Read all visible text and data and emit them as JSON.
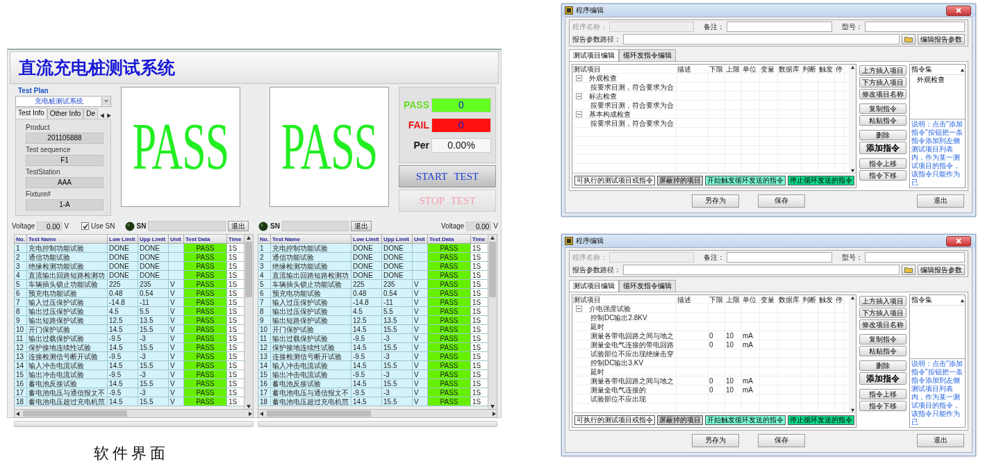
{
  "test_app": {
    "title": "直流充电桩测试系统",
    "test_plan": {
      "label": "Test Plan",
      "plan": "充电桩测试系统",
      "tabs": [
        {
          "label": "Test Info",
          "selected": true
        },
        {
          "label": "Other Info",
          "selected": false
        },
        {
          "label": "De",
          "selected": false
        }
      ],
      "fields": [
        {
          "label": "Product",
          "value": "201105888"
        },
        {
          "label": "Test sequence",
          "value": "F1"
        },
        {
          "label": "TestStation",
          "value": "AAA"
        },
        {
          "label": "Fixture#",
          "value": "1-A"
        }
      ]
    },
    "result_displays": [
      "PASS",
      "PASS"
    ],
    "counters": [
      {
        "kind": "pass",
        "label": "PASS",
        "value": "0"
      },
      {
        "kind": "fail",
        "label": "FAIL",
        "value": "0"
      },
      {
        "kind": "per",
        "label": "Per",
        "value": "0.00%"
      }
    ],
    "buttons": [
      {
        "label": "START TEST",
        "disabled": false
      },
      {
        "label": "STOP TEST",
        "disabled": true
      }
    ],
    "stations": [
      {
        "voltage_label": "Voltage",
        "voltage": "0.00",
        "voltage_unit": "V",
        "use_sn": {
          "label": "Use SN",
          "checked": true
        },
        "sn_label": "SN",
        "exit": "退出",
        "table": {
          "columns": [
            "No.",
            "Test Name",
            "Low Limit",
            "Upp Limit",
            "Unit",
            "Test Data",
            "Time"
          ],
          "rows": [
            {
              "no": "1",
              "name": "充电控制功能试验",
              "low": "DONE",
              "upp": "DONE",
              "data": "PASS",
              "time": "1S"
            },
            {
              "no": "2",
              "name": "通信功能试验",
              "low": "DONE",
              "upp": "DONE",
              "data": "PASS",
              "time": "1S"
            },
            {
              "no": "3",
              "name": "绝缘检测功能试验",
              "low": "DONE",
              "upp": "DONE",
              "data": "PASS",
              "time": "1S"
            },
            {
              "no": "4",
              "name": "直流输出回路短路检测功",
              "low": "DONE",
              "upp": "DONE",
              "data": "PASS",
              "time": "1S"
            },
            {
              "no": "5",
              "name": "车辆插头锁止功能试验",
              "low": "225",
              "upp": "235",
              "unit": "V",
              "data": "PASS",
              "time": "1S"
            },
            {
              "no": "6",
              "name": "预充电功能试验",
              "low": "0.48",
              "upp": "0.54",
              "unit": "V",
              "data": "PASS",
              "time": "1S"
            },
            {
              "no": "7",
              "name": "输入过压保护试验",
              "low": "-14.8",
              "upp": "-11",
              "unit": "V",
              "data": "PASS",
              "time": "1S"
            },
            {
              "no": "8",
              "name": "输出过压保护试验",
              "low": "4.5",
              "upp": "5.5",
              "unit": "V",
              "data": "PASS",
              "time": "1S"
            },
            {
              "no": "9",
              "name": "输出短路保护试验",
              "low": "12.5",
              "upp": "13.5",
              "unit": "V",
              "data": "PASS",
              "time": "1S"
            },
            {
              "no": "10",
              "name": "开门保护试验",
              "low": "14.5",
              "upp": "15.5",
              "unit": "V",
              "data": "PASS",
              "time": "1S"
            },
            {
              "no": "11",
              "name": "输出过载保护试验",
              "low": "-9.5",
              "upp": "-3",
              "unit": "V",
              "data": "PASS",
              "time": "1S"
            },
            {
              "no": "12",
              "name": "保护接地连续性试验",
              "low": "14.5",
              "upp": "15.5",
              "unit": "V",
              "data": "PASS",
              "time": "1S"
            },
            {
              "no": "13",
              "name": "连接检测信号断开试验",
              "low": "-9.5",
              "upp": "-3",
              "unit": "V",
              "data": "PASS",
              "time": "1S"
            },
            {
              "no": "14",
              "name": "输入冲击电流试验",
              "low": "14.5",
              "upp": "15.5",
              "unit": "V",
              "data": "PASS",
              "time": "1S"
            },
            {
              "no": "15",
              "name": "输出冲击电流试验",
              "low": "-9.5",
              "upp": "-3",
              "unit": "V",
              "data": "PASS",
              "time": "1S"
            },
            {
              "no": "16",
              "name": "蓄电池反接试验",
              "low": "14.5",
              "upp": "15.5",
              "unit": "V",
              "data": "PASS",
              "time": "1S"
            },
            {
              "no": "17",
              "name": "蓄电池电压与通信报文不",
              "low": "-9.5",
              "upp": "-3",
              "unit": "V",
              "data": "PASS",
              "time": "1S"
            },
            {
              "no": "18",
              "name": "蓄电池电压超过充电机范",
              "low": "14.5",
              "upp": "15.5",
              "unit": "V",
              "data": "PASS",
              "time": "1S"
            }
          ]
        }
      },
      {
        "voltage_label": "Voltage",
        "voltage": "0.00",
        "voltage_unit": "V",
        "sn_label": "SN",
        "exit": "退出",
        "table": {
          "columns": [
            "No.",
            "Test Name",
            "Low Limit",
            "Upp Limit",
            "Unit",
            "Test Data",
            "Time"
          ],
          "rows": [
            {
              "no": "1",
              "name": "充电控制功能试验",
              "low": "DONE",
              "upp": "DONE",
              "data": "PASS",
              "time": "1S"
            },
            {
              "no": "2",
              "name": "通信功能试验",
              "low": "DONE",
              "upp": "DONE",
              "data": "PASS",
              "time": "1S"
            },
            {
              "no": "3",
              "name": "绝缘检测功能试验",
              "low": "DONE",
              "upp": "DONE",
              "data": "PASS",
              "time": "1S"
            },
            {
              "no": "4",
              "name": "直流输出回路短路检测功",
              "low": "DONE",
              "upp": "DONE",
              "data": "PASS",
              "time": "1S"
            },
            {
              "no": "5",
              "name": "车辆插头锁止功能试验",
              "low": "225",
              "upp": "235",
              "unit": "V",
              "data": "PASS",
              "time": "1S"
            },
            {
              "no": "6",
              "name": "预充电功能试验",
              "low": "0.48",
              "upp": "0.54",
              "unit": "V",
              "data": "PASS",
              "time": "1S"
            },
            {
              "no": "7",
              "name": "输入过压保护试验",
              "low": "-14.8",
              "upp": "-11",
              "unit": "V",
              "data": "PASS",
              "time": "1S"
            },
            {
              "no": "8",
              "name": "输出过压保护试验",
              "low": "4.5",
              "upp": "5.5",
              "unit": "V",
              "data": "PASS",
              "time": "1S"
            },
            {
              "no": "9",
              "name": "输出短路保护试验",
              "low": "12.5",
              "upp": "13.5",
              "unit": "V",
              "data": "PASS",
              "time": "1S"
            },
            {
              "no": "10",
              "name": "开门保护试验",
              "low": "14.5",
              "upp": "15.5",
              "unit": "V",
              "data": "PASS",
              "time": "1S"
            },
            {
              "no": "11",
              "name": "输出过载保护试验",
              "low": "-9.5",
              "upp": "-3",
              "unit": "V",
              "data": "PASS",
              "time": "1S"
            },
            {
              "no": "12",
              "name": "保护接地连续性试验",
              "low": "14.5",
              "upp": "15.5",
              "unit": "V",
              "data": "PASS",
              "time": "1S"
            },
            {
              "no": "13",
              "name": "连接检测信号断开试验",
              "low": "-9.5",
              "upp": "-3",
              "unit": "V",
              "data": "PASS",
              "time": "1S"
            },
            {
              "no": "14",
              "name": "输入冲击电流试验",
              "low": "14.5",
              "upp": "15.5",
              "unit": "V",
              "data": "PASS",
              "time": "1S"
            },
            {
              "no": "15",
              "name": "输出冲击电流试验",
              "low": "-9.5",
              "upp": "-3",
              "unit": "V",
              "data": "PASS",
              "time": "1S"
            },
            {
              "no": "16",
              "name": "蓄电池反接试验",
              "low": "14.5",
              "upp": "15.5",
              "unit": "V",
              "data": "PASS",
              "time": "1S"
            },
            {
              "no": "17",
              "name": "蓄电池电压与通信报文不",
              "low": "-9.5",
              "upp": "-3",
              "unit": "V",
              "data": "PASS",
              "time": "1S"
            },
            {
              "no": "18",
              "name": "蓄电池电压超过充电机范",
              "low": "14.5",
              "upp": "15.5",
              "unit": "V",
              "data": "PASS",
              "time": "1S"
            }
          ]
        }
      }
    ]
  },
  "caption": "软件界面",
  "editors": [
    {
      "title": "程序编辑",
      "fields": [
        {
          "label": "程序名称：",
          "disabled": true
        },
        {
          "label": "备注：",
          "disabled": false
        },
        {
          "label": "型号：",
          "disabled": false
        },
        {
          "label": "报告参数路径：",
          "disabled": false
        }
      ],
      "report_button": "编辑报告参数",
      "tabs": [
        {
          "label": "测试项目编辑",
          "selected": true
        },
        {
          "label": "循环发指令编辑",
          "selected": false
        }
      ],
      "columns": [
        "测试项目",
        "描述",
        "下限",
        "上限",
        "单位",
        "变量",
        "数据库",
        "判断",
        "触发",
        "停"
      ],
      "items": [
        {
          "name": "外观检查",
          "expanded": true,
          "children": [
            {
              "name": "按要求目测，符合要求为合"
            }
          ]
        },
        {
          "name": "标志检查",
          "expanded": true,
          "children": [
            {
              "name": "按要求目测，符合要求为合"
            }
          ]
        },
        {
          "name": "基本构成检查",
          "expanded": true,
          "children": [
            {
              "name": "按要求目测，符合要求为合"
            }
          ]
        }
      ],
      "actions": [
        [
          {
            "label": "上方插入项目",
            "kind": "normal"
          },
          {
            "label": "下方插入项目",
            "kind": "normal"
          },
          {
            "label": "修改项目名称",
            "kind": "normal"
          }
        ],
        [
          {
            "label": "复制指令",
            "kind": "normal"
          },
          {
            "label": "粘贴指令",
            "kind": "normal"
          }
        ],
        [
          {
            "label": "删除",
            "kind": "normal"
          },
          {
            "label": "添加指令",
            "kind": "primary"
          }
        ],
        [
          {
            "label": "指令上移",
            "kind": "normal"
          },
          {
            "label": "指令下移",
            "kind": "normal"
          }
        ]
      ],
      "command_set": {
        "title": "指令集",
        "items": [
          "外观检查"
        ]
      },
      "note": "说明：点击\"添加指令\"按钮把一条指令添加到左侧测试项目列表内，作为某一测试项目的指令，该指令只能作为已",
      "legend": [
        {
          "label": "可执行的测试项目或指令",
          "color": "#ffffff"
        },
        {
          "label": "屏蔽掉的项目",
          "color": "#d0d0d0"
        },
        {
          "label": "开始触发循环发送的指令",
          "color": "#7dfcd8"
        },
        {
          "label": "停止循环发送的指令",
          "color": "#11d98a"
        }
      ],
      "footer_buttons": [
        "另存为",
        "保存",
        "退出"
      ]
    },
    {
      "title": "程序编辑",
      "fields": [
        {
          "label": "程序名称：",
          "disabled": true
        },
        {
          "label": "备注：",
          "disabled": false
        },
        {
          "label": "型号：",
          "disabled": false
        },
        {
          "label": "报告参数路径：",
          "disabled": false
        }
      ],
      "report_button": "编辑报告参数",
      "tabs": [
        {
          "label": "测试项目编辑",
          "selected": true
        },
        {
          "label": "循环发指令编辑",
          "selected": false
        }
      ],
      "columns": [
        "测试项目",
        "描述",
        "下限",
        "上限",
        "单位",
        "变量",
        "数据库",
        "判断",
        "触发",
        "停"
      ],
      "items": [
        {
          "name": "介电强度试验",
          "expanded": true,
          "children": [
            {
              "name": "控制DC输出2.8KV"
            },
            {
              "name": "延时"
            },
            {
              "name": "测量各带电回路之间与地之",
              "lower": "0",
              "upper": "10",
              "unit": "mA"
            },
            {
              "name": "测量全电气连接的带电回路",
              "lower": "0",
              "upper": "10",
              "unit": "mA"
            },
            {
              "name": "试验部位不应出现绝缘击穿"
            },
            {
              "name": "控制DC输出3.KV"
            },
            {
              "name": "延时"
            },
            {
              "name": "测量各带电回路之间与地之",
              "lower": "0",
              "upper": "10",
              "unit": "mA"
            },
            {
              "name": "测量全电气连接的",
              "lower": "0",
              "upper": "10",
              "unit": "mA"
            },
            {
              "name": "试验部位不应出现"
            }
          ]
        }
      ],
      "actions": [
        [
          {
            "label": "上方插入项目",
            "kind": "normal"
          },
          {
            "label": "下方插入项目",
            "kind": "normal"
          },
          {
            "label": "修改项目名称",
            "kind": "normal"
          }
        ],
        [
          {
            "label": "复制指令",
            "kind": "normal"
          },
          {
            "label": "粘贴指令",
            "kind": "normal"
          }
        ],
        [
          {
            "label": "删除",
            "kind": "normal"
          },
          {
            "label": "添加指令",
            "kind": "primary"
          }
        ],
        [
          {
            "label": "指令上移",
            "kind": "normal"
          },
          {
            "label": "指令下移",
            "kind": "normal"
          }
        ]
      ],
      "command_set": {
        "title": "指令集"
      },
      "note": "说明：点击\"添加指令\"按钮把一条指令添加到左侧测试项目列表内，作为某一测试项目的指令，该指令只能作为已",
      "legend": [
        {
          "label": "可执行的测试项目或指令",
          "color": "#ffffff"
        },
        {
          "label": "屏蔽掉的项目",
          "color": "#d0d0d0"
        },
        {
          "label": "开始触发循环发送的指令",
          "color": "#7dfcd8"
        },
        {
          "label": "停止循环发送的指令",
          "color": "#11d98a"
        }
      ],
      "footer_buttons": [
        "另存为",
        "保存",
        "退出"
      ]
    }
  ]
}
